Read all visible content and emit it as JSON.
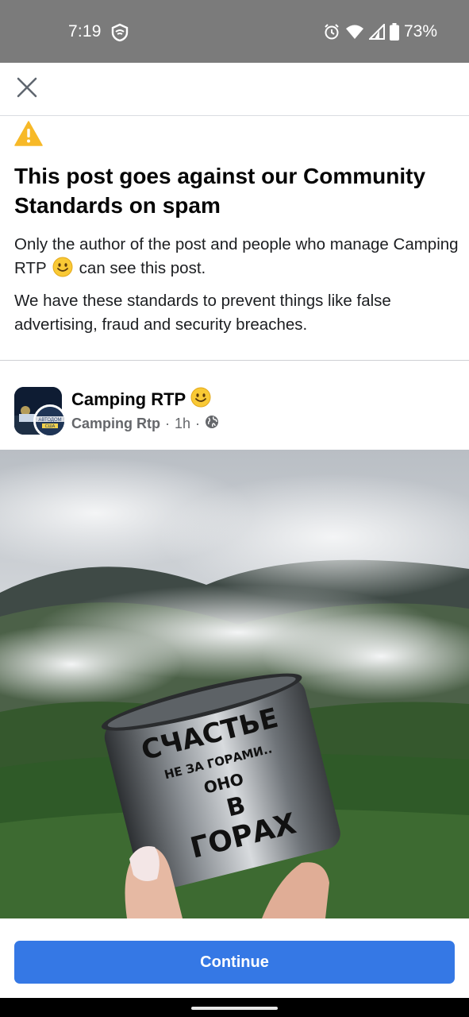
{
  "status_bar": {
    "time": "7:19",
    "battery": "73%"
  },
  "notice": {
    "title": "This post goes against our Community Standards on spam",
    "p1_before": "Only the author of the post and people who manage Camping RTP",
    "p1_after": "can see this post.",
    "p2": "We have these standards to prevent things like false advertising, fraud and security breaches."
  },
  "post": {
    "page_name": "Camping RTP",
    "author": "Camping Rtp",
    "time": "1h",
    "separator": "·",
    "avatar_text_line1": "АВТОДОМ",
    "avatar_text_line2": "США",
    "mug_text": {
      "line1": "СЧАСТЬЕ",
      "line2": "НЕ ЗА ГОРАМИ..",
      "line3": "ОНО",
      "line4": "В",
      "line5": "ГОРАХ"
    }
  },
  "actions": {
    "continue_label": "Continue"
  },
  "colors": {
    "accent": "#3578e5",
    "status_bar": "#7b7b7b",
    "warning": "#f7b928"
  }
}
